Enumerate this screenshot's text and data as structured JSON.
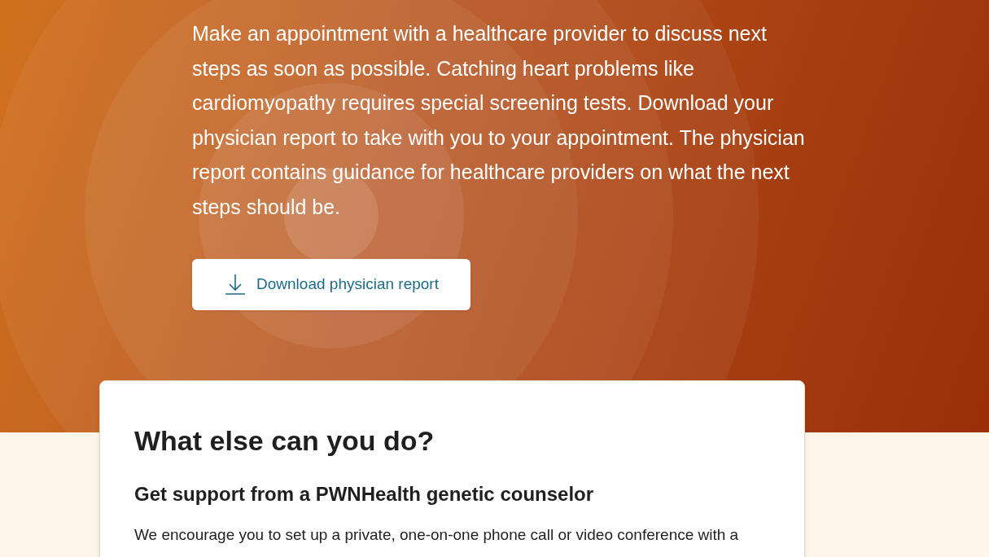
{
  "hero": {
    "message": "Make an appointment with a healthcare provider to discuss next steps as soon as possible. Catching heart problems like cardiomyopathy requires special screening tests. Download your physician report to take with you to your appointment. The physician report contains guidance for healthcare providers on what the next steps should be.",
    "button": {
      "label": "Download physician report"
    }
  },
  "card": {
    "title": "What else can you do?",
    "sections": [
      {
        "heading": "Get support from a PWNHealth genetic counselor",
        "text": "We encourage you to set up a private, one-on-one phone call or video conference with a"
      }
    ]
  }
}
